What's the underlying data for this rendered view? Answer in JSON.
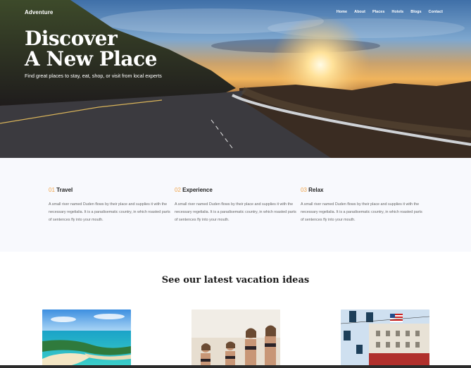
{
  "header": {
    "brand": "Adventure",
    "nav": [
      "Home",
      "About",
      "Places",
      "Hotels",
      "Blogs",
      "Contact"
    ]
  },
  "hero": {
    "title_line1": "Discover",
    "title_line2": "A New Place",
    "subtitle": "Find great places to stay, eat, shop, or visit from local experts"
  },
  "features": [
    {
      "num": "01",
      "title": "Travel",
      "text": "A small river named Duden flows by their place and supplies it with the necessary regelialia. It is a paradisematic country, in which roasted parts of sentences fly into your mouth."
    },
    {
      "num": "02",
      "title": "Experience",
      "text": "A small river named Duden flows by their place and supplies it with the necessary regelialia. It is a paradisematic country, in which roasted parts of sentences fly into your mouth."
    },
    {
      "num": "03",
      "title": "Relax",
      "text": "A small river named Duden flows by their place and supplies it with the necessary regelialia. It is a paradisematic country, in which roasted parts of sentences fly into your mouth."
    }
  ],
  "section": {
    "title": "See our latest vacation ideas"
  },
  "colors": {
    "accent": "#f0a44a",
    "features_bg": "#f8f9fd"
  }
}
